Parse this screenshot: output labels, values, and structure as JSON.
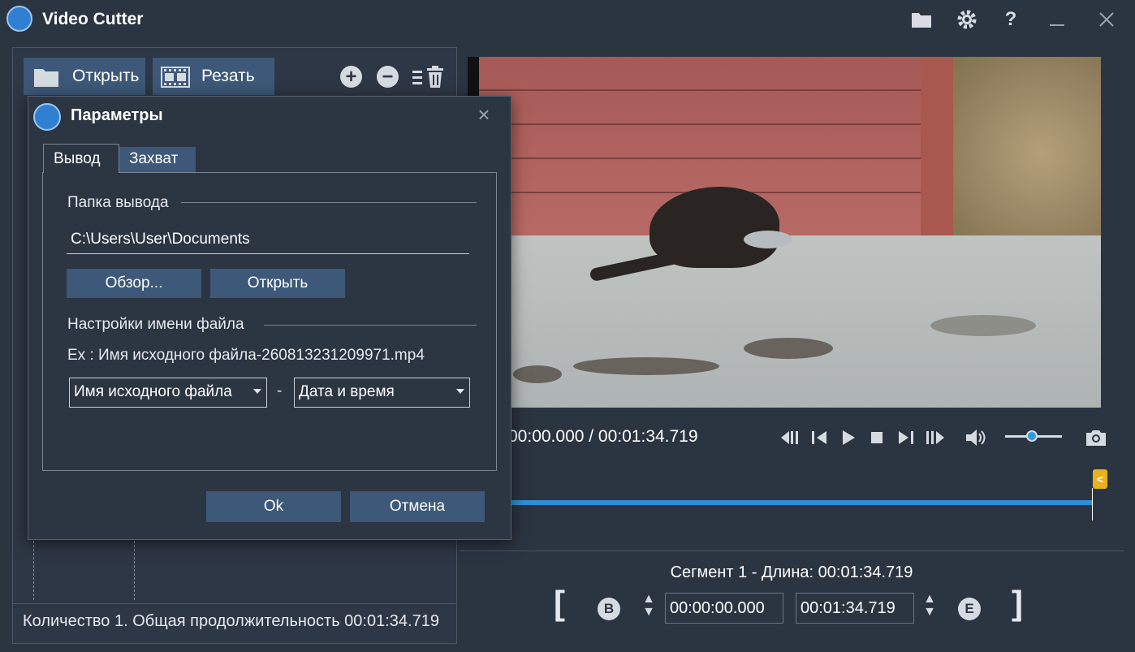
{
  "app": {
    "title": "Video Cutter"
  },
  "titlebar": {
    "icons": [
      "folder-icon",
      "gear-icon",
      "help-icon",
      "minimize-icon",
      "close-icon"
    ]
  },
  "toolbar": {
    "open_label": "Открыть",
    "cut_label": "Резать"
  },
  "status": {
    "text": "Количество 1. Общая продолжительность 00:01:34.719"
  },
  "player": {
    "time": "00:00.000 / 00:01:34.719",
    "volume_level": 0.5
  },
  "segment": {
    "title": "Сегмент 1 - Длина: 00:01:34.719",
    "begin_letter": "B",
    "end_letter": "E",
    "start_time": "00:00:00.000",
    "end_time": "00:01:34.719"
  },
  "dialog": {
    "title": "Параметры",
    "tabs": [
      {
        "label": "Вывод"
      },
      {
        "label": "Захват"
      }
    ],
    "output_folder_label": "Папка вывода",
    "output_path": "C:\\Users\\User\\Documents",
    "browse_label": "Обзор...",
    "open_label": "Открыть",
    "filename_settings_label": "Настройки имени файла",
    "example": "Ex : Имя исходного файла-260813231209971.mp4",
    "name_part1": "Имя исходного файла",
    "separator": "-",
    "name_part2": "Дата и время",
    "ok_label": "Ok",
    "cancel_label": "Отмена"
  },
  "colors": {
    "accent": "#2f8fd6",
    "button": "#3d5878",
    "marker": "#e9b21b"
  }
}
